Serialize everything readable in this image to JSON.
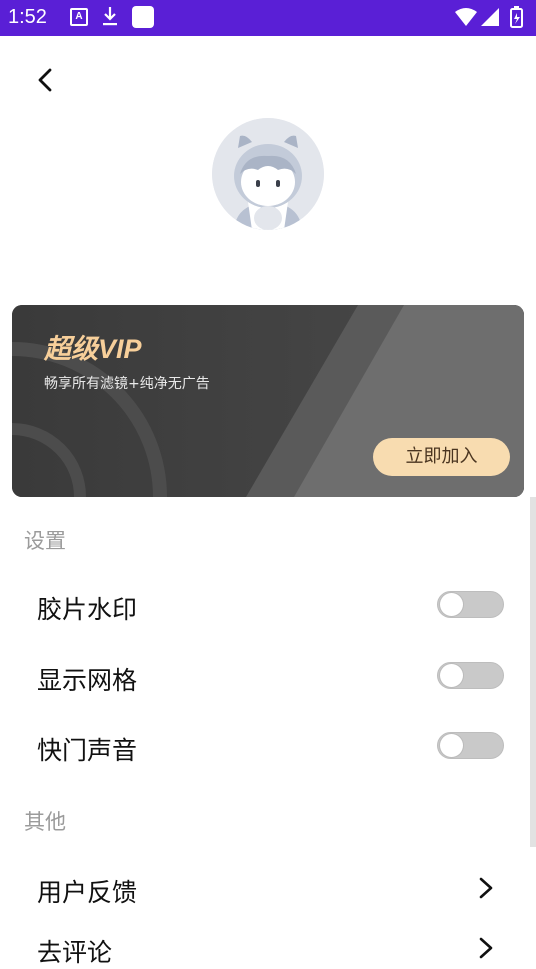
{
  "status_bar": {
    "time": "1:52",
    "a_icon_letter": "A",
    "icons_left": [
      "a-notification-icon",
      "download-icon",
      "blank-notification-icon"
    ],
    "icons_right": [
      "wifi-icon",
      "signal-icon",
      "battery-icon"
    ]
  },
  "colors": {
    "status_bar": "#5a1fd6",
    "vip_title": "#f7cf9a",
    "vip_button_bg": "#f8dcb0",
    "toggle_off": "#c9c9c9"
  },
  "vip": {
    "title": "超级VIP",
    "subtitle": "畅享所有滤镜+纯净无广告",
    "join_label": "立即加入"
  },
  "settings": {
    "title": "设置",
    "items": [
      {
        "label": "胶片水印",
        "enabled": false
      },
      {
        "label": "显示网格",
        "enabled": false
      },
      {
        "label": "快门声音",
        "enabled": false
      }
    ]
  },
  "other": {
    "title": "其他",
    "items": [
      {
        "label": "用户反馈"
      },
      {
        "label": "去评论"
      }
    ]
  }
}
